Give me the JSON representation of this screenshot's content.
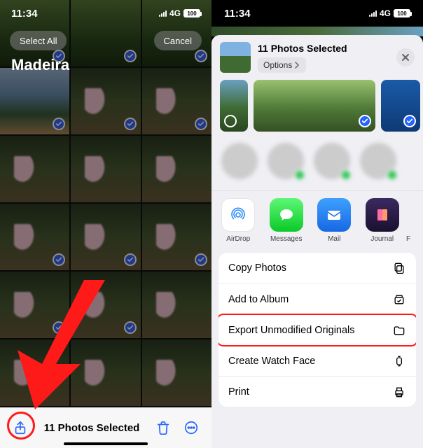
{
  "status": {
    "time": "11:34",
    "network": "4G",
    "battery": "100"
  },
  "left": {
    "select_all": "Select All",
    "cancel": "Cancel",
    "album": "Madeira",
    "selected_label": "11 Photos Selected"
  },
  "right": {
    "title": "11 Photos Selected",
    "options": "Options",
    "apps": {
      "airdrop": "AirDrop",
      "messages": "Messages",
      "mail": "Mail",
      "journal": "Journal",
      "more": "F"
    },
    "actions": {
      "copy": "Copy Photos",
      "add_album": "Add to Album",
      "export": "Export Unmodified Originals",
      "watch_face": "Create Watch Face",
      "print": "Print"
    }
  }
}
